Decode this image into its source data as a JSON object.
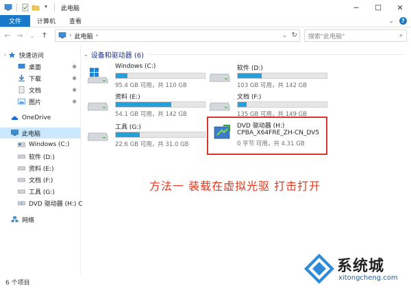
{
  "window": {
    "title": "此电脑",
    "controls": [
      "minimize",
      "maximize",
      "close"
    ]
  },
  "ribbon": {
    "tabs": [
      "文件",
      "计算机",
      "查看"
    ]
  },
  "address": {
    "crumbs": [
      "此电脑"
    ],
    "search_placeholder": "搜索\"此电脑\""
  },
  "nav": {
    "quick_access": "快速访问",
    "quick_items": [
      "桌面",
      "下载",
      "文档",
      "图片"
    ],
    "onedrive": "OneDrive",
    "this_pc": "此电脑",
    "pc_items": [
      "Windows (C:)",
      "软件 (D:)",
      "资料 (E:)",
      "文档 (F:)",
      "工具 (G:)",
      "DVD 驱动器 (H:) C"
    ],
    "network": "网络"
  },
  "main": {
    "group_title": "设备和驱动器 (6)",
    "drives": [
      {
        "name": "Windows (C:)",
        "free": "95.4 GB 可用，共 110 GB",
        "used_fraction": 0.13
      },
      {
        "name": "软件 (D:)",
        "free": "103 GB 可用，共 142 GB",
        "used_fraction": 0.27
      },
      {
        "name": "资料 (E:)",
        "free": "54.1 GB 可用，共 142 GB",
        "used_fraction": 0.62
      },
      {
        "name": "文档 (F:)",
        "free": "135 GB 可用，共 149 GB",
        "used_fraction": 0.1
      },
      {
        "name": "工具 (G:)",
        "free": "22.6 GB 可用，共 31.0 GB",
        "used_fraction": 0.27
      }
    ],
    "dvd": {
      "name": "DVD 驱动器 (H:)",
      "label": "CPBA_X64FRE_ZH-CN_DV5",
      "free": "0 字节 可用，共 4.31 GB"
    },
    "annotation": "方法一 装载在虚拟光驱 打击打开"
  },
  "status": {
    "items": "6 个项目"
  },
  "watermark": {
    "brand": "系统城",
    "url": "xitongcheng.com"
  },
  "colors": {
    "accent": "#1979ca",
    "bar_fill": "#26a0da",
    "highlight_border": "#d6342c",
    "annotation": "#e2371d"
  }
}
